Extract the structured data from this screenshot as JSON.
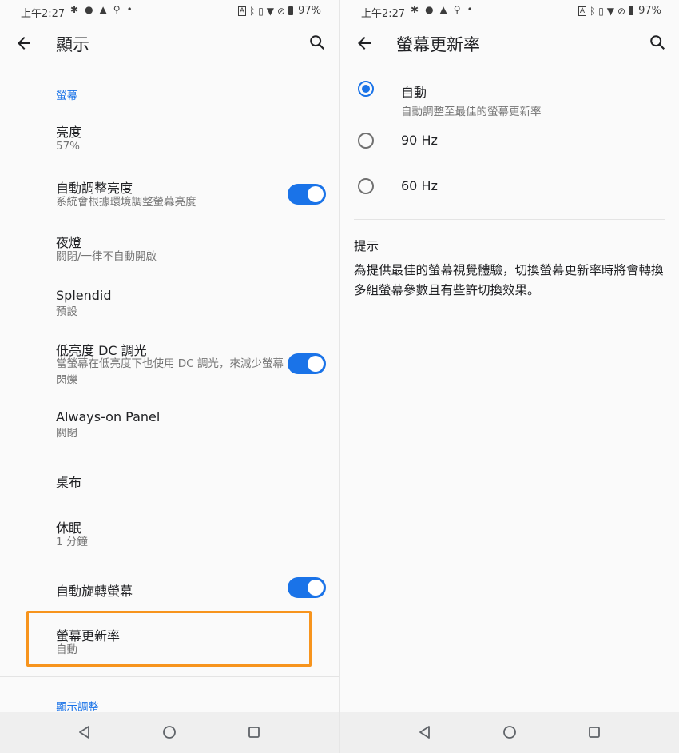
{
  "status_bar": {
    "time": "上午2:27",
    "battery_text": "97%",
    "left_icons": [
      "gear-icon",
      "notification-icon",
      "drive-icon",
      "location-icon",
      "dot-icon"
    ],
    "right_icons": [
      "auto-brightness-icon",
      "bluetooth-icon",
      "vibrate-icon",
      "wifi-icon",
      "no-sim-icon",
      "battery-icon"
    ]
  },
  "left_screen": {
    "title": "顯示",
    "section_screen": "螢幕",
    "items": [
      {
        "title": "亮度",
        "subtitle": "57%"
      },
      {
        "title": "自動調整亮度",
        "subtitle": "系統會根據環境調整螢幕亮度",
        "toggle": true
      },
      {
        "title": "夜燈",
        "subtitle": "關閉/一律不自動開啟"
      },
      {
        "title": "Splendid",
        "subtitle": "預設"
      },
      {
        "title": "低亮度 DC 調光",
        "subtitle": "當螢幕在低亮度下也使用 DC 調光，來減少螢幕閃爍",
        "toggle": true
      },
      {
        "title": "Always-on Panel",
        "subtitle": "關閉"
      },
      {
        "title": "桌布",
        "subtitle": ""
      },
      {
        "title": "休眠",
        "subtitle": "1 分鐘"
      },
      {
        "title": "自動旋轉螢幕",
        "subtitle": "",
        "toggle": true
      },
      {
        "title": "螢幕更新率",
        "subtitle": "自動"
      }
    ],
    "section_adjust": "顯示調整"
  },
  "right_screen": {
    "title": "螢幕更新率",
    "options": [
      {
        "label": "自動",
        "subtitle": "自動調整至最佳的螢幕更新率",
        "selected": true
      },
      {
        "label": "90 Hz",
        "subtitle": "",
        "selected": false
      },
      {
        "label": "60 Hz",
        "subtitle": "",
        "selected": false
      }
    ],
    "hint_title": "提示",
    "hint_body": "為提供最佳的螢幕視覺體驗，切換螢幕更新率時將會轉換多組螢幕參數且有些許切換效果。"
  },
  "colors": {
    "accent": "#1a73e8",
    "highlight": "#f7941d",
    "background": "#fafafa",
    "secondary_text": "#757575"
  }
}
